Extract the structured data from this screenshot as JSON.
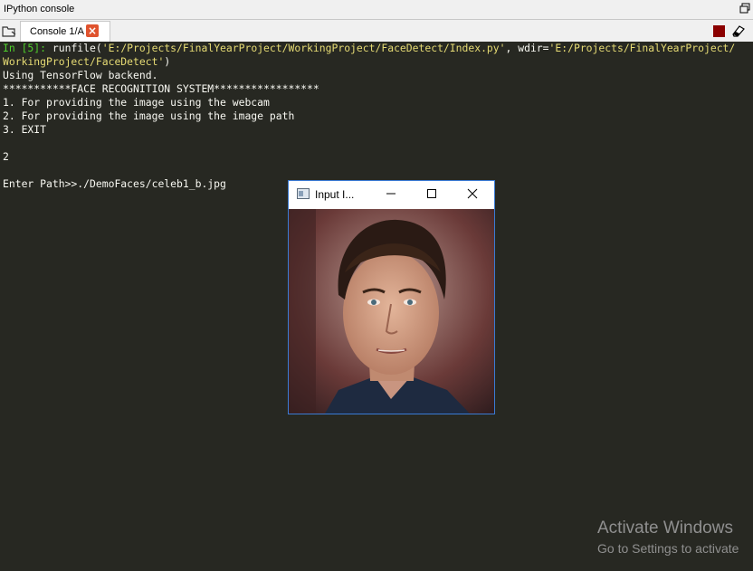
{
  "panel": {
    "title": "IPython console"
  },
  "tab": {
    "label": "Console 1/A",
    "close_glyph": "×"
  },
  "console": {
    "line1_prompt": "In [5]:",
    "line1_cmd": " runfile(",
    "line1_str1": "'E:/Projects/FinalYearProject/WorkingProject/FaceDetect/Index.py'",
    "line1_mid": ", wdir=",
    "line1_str2": "'E:/Projects/FinalYearProject/",
    "line2_str": "WorkingProject/FaceDetect'",
    "line2_end": ")",
    "line3": "Using TensorFlow backend.",
    "line4": "***********FACE RECOGNITION SYSTEM*****************",
    "line5": "1. For providing the image using the webcam",
    "line6": "2. For providing the image using the image path",
    "line7": "3. EXIT",
    "line9": "2",
    "line11": "Enter Path>>./DemoFaces/celeb1_b.jpg"
  },
  "image_window": {
    "title": "Input I...",
    "icons": [
      "app-icon",
      "minimize-icon",
      "maximize-icon",
      "close-icon"
    ]
  },
  "watermark": {
    "line1": "Activate Windows",
    "line2": "Go to Settings to activate"
  },
  "colors": {
    "console_bg": "#272822",
    "prompt": "#4fcf2b",
    "string": "#e6db74",
    "stop_button": "#8b0000",
    "tab_close": "#e0532e"
  }
}
